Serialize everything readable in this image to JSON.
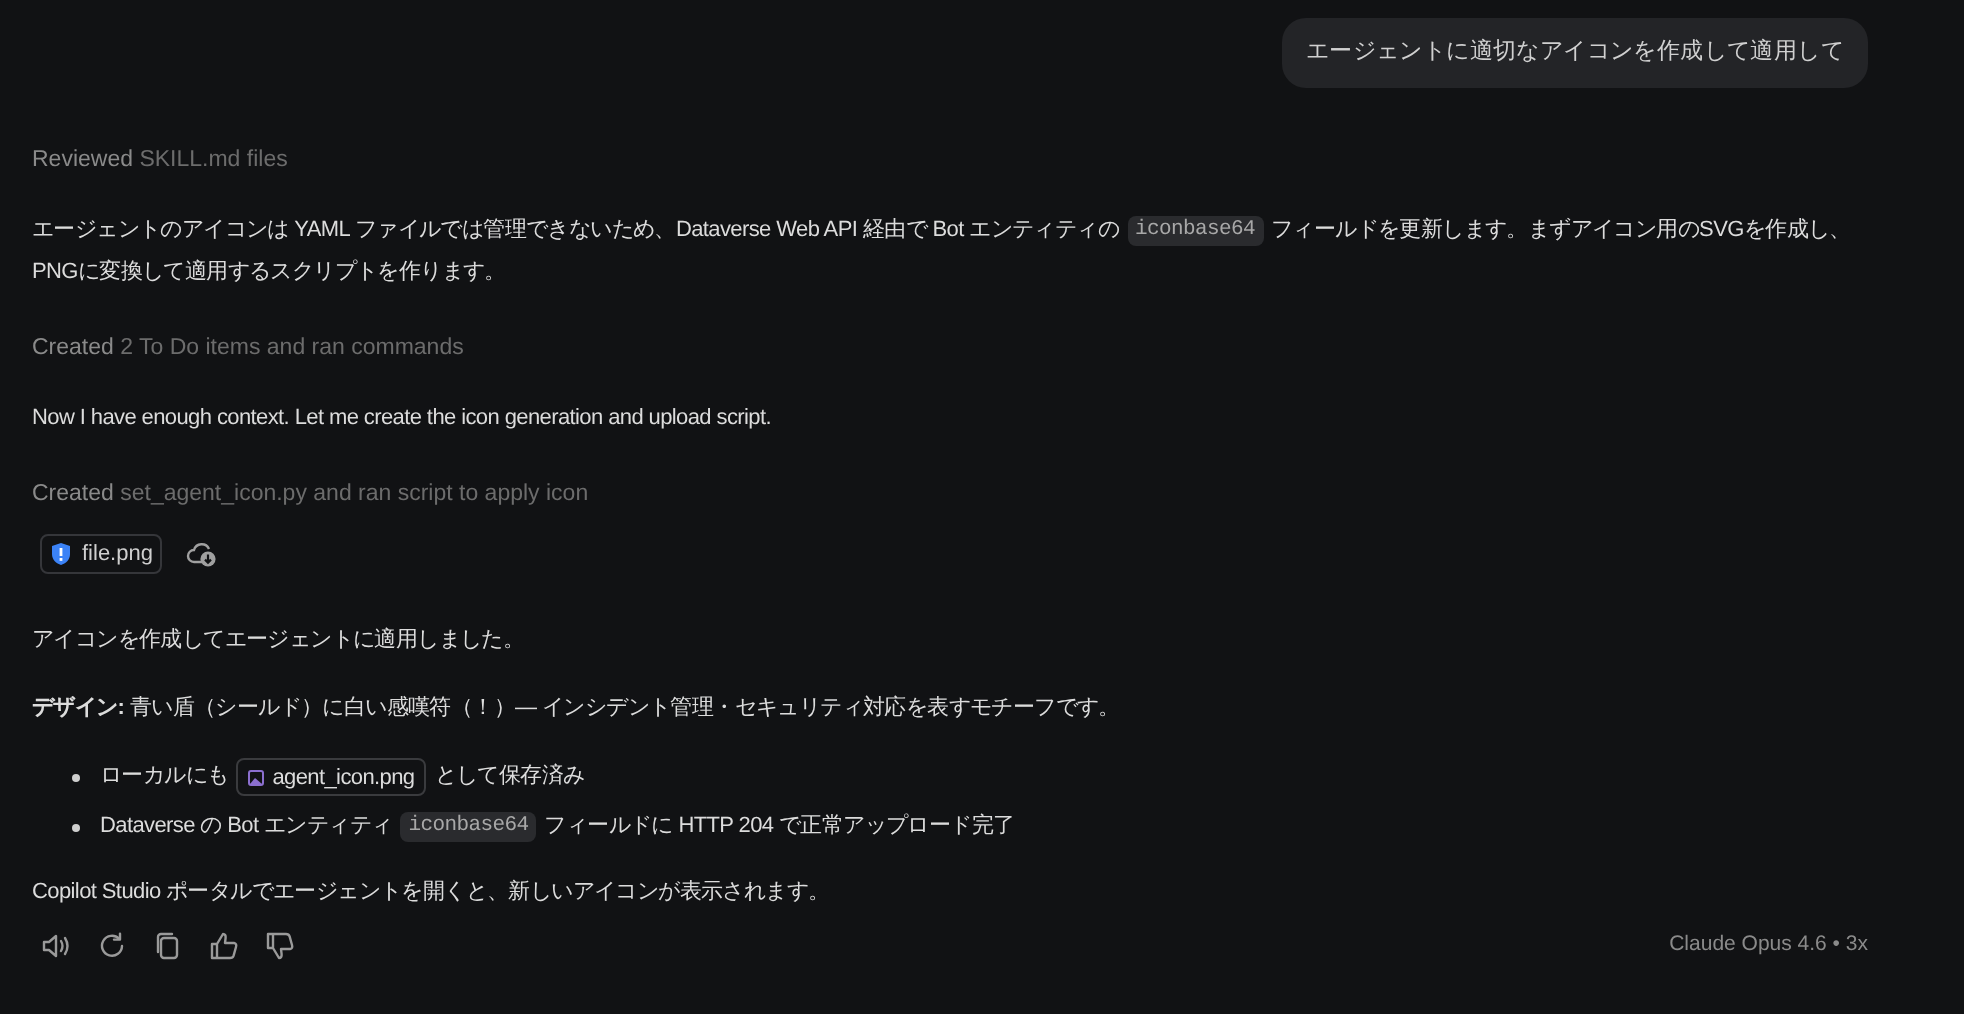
{
  "user_message": {
    "text": "エージェントに適切なアイコンを作成して適用して"
  },
  "blocks": [
    {
      "kind": "activity",
      "verb": "Reviewed",
      "detail": "SKILL.md files"
    },
    {
      "kind": "paragraph",
      "lines": [
        [
          {
            "kind": "text",
            "text": "エージェントのアイコンは YAML ファイルでは管理できないため、Dataverse Web API 経由で Bot エンティティの"
          },
          {
            "kind": "code",
            "text": "iconbase64"
          },
          {
            "kind": "text",
            "text": "フィールドを更新します。まずアイコン用のSVGを作成し、"
          }
        ],
        [
          {
            "kind": "text",
            "text": "PNGに変換して適用するスクリプトを作ります。"
          }
        ]
      ]
    },
    {
      "kind": "activity",
      "verb": "Created",
      "detail": "2 To Do items and ran commands"
    },
    {
      "kind": "paragraph",
      "lines": [
        [
          {
            "kind": "text",
            "text": "Now I have enough context. Let me create the icon generation and upload script."
          }
        ]
      ]
    },
    {
      "kind": "activity",
      "verb": "Created",
      "detail": "set_agent_icon.py and ran script to apply icon"
    },
    {
      "kind": "attachments",
      "file": "file.png"
    },
    {
      "kind": "paragraph",
      "lines": [
        [
          {
            "kind": "text",
            "text": "アイコンを作成してエージェントに適用しました。"
          }
        ]
      ]
    },
    {
      "kind": "paragraph",
      "lines": [
        [
          {
            "kind": "text",
            "text": "**デザイン:** 青い盾（シールド）に白い感嘆符（！）— インシデント管理・セキュリティ対応を表すモチーフです。"
          }
        ]
      ]
    },
    {
      "kind": "list",
      "items": [
        {
          "segments": [
            {
              "kind": "text",
              "text": "ローカルにも"
            },
            {
              "kind": "file",
              "text": "agent_icon.png"
            },
            {
              "kind": "text",
              "text": "として保存済み"
            }
          ]
        },
        {
          "segments": [
            {
              "kind": "text",
              "text": "Dataverse の Bot エンティティ"
            },
            {
              "kind": "code",
              "text": "iconbase64"
            },
            {
              "kind": "text",
              "text": "フィールドに HTTP 204 で正常アップロード完了"
            }
          ]
        }
      ]
    },
    {
      "kind": "paragraph",
      "lines": [
        [
          {
            "kind": "text",
            "text": "Copilot Studio ポータルでエージェントを開くと、新しいアイコンが表示されます。"
          }
        ]
      ]
    }
  ],
  "footer": {
    "model": "Claude Opus 4.6 • 3x"
  }
}
